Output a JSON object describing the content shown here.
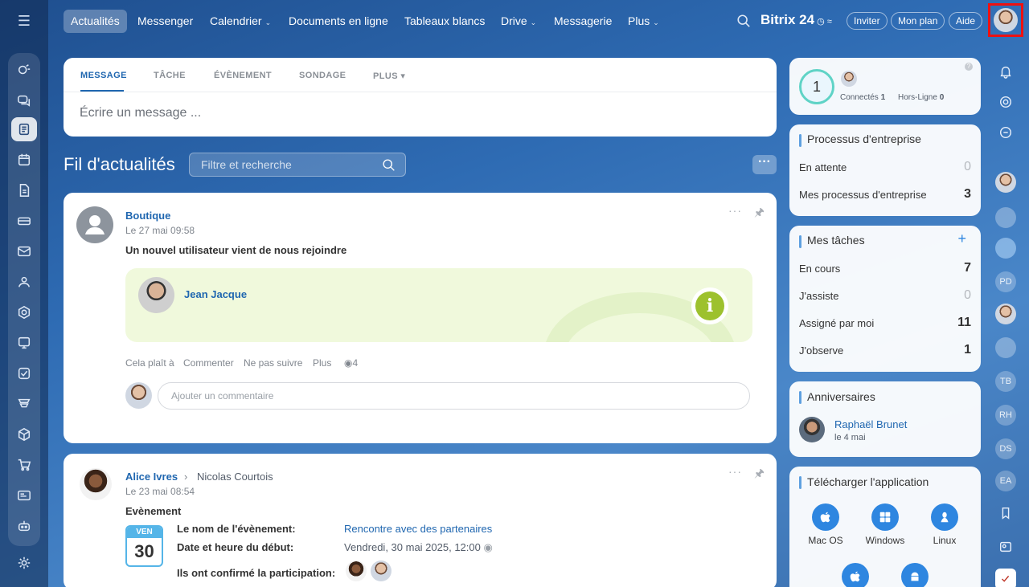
{
  "topbar": {
    "tabs": [
      {
        "label": "Actualités",
        "active": true
      },
      {
        "label": "Messenger"
      },
      {
        "label": "Calendrier",
        "dropdown": true
      },
      {
        "label": "Documents en ligne"
      },
      {
        "label": "Tableaux blancs"
      },
      {
        "label": "Drive",
        "dropdown": true
      },
      {
        "label": "Messagerie"
      },
      {
        "label": "Plus",
        "dropdown": true
      }
    ],
    "brand": "Bitrix 24",
    "invite_label": "Inviter",
    "plan_label": "Mon plan",
    "help_label": "Aide"
  },
  "composer": {
    "tabs": [
      "MESSAGE",
      "TÂCHE",
      "ÉVÈNEMENT",
      "SONDAGE",
      "PLUS"
    ],
    "placeholder": "Écrire un message ..."
  },
  "feed": {
    "title": "Fil d'actualités",
    "search_placeholder": "Filtre et recherche"
  },
  "post1": {
    "author": "Boutique",
    "date": "Le 27 mai 09:58",
    "text": "Un nouvel utilisateur vient de nous rejoindre",
    "new_user": "Jean Jacque",
    "actions": {
      "like": "Cela plaît à",
      "comment": "Commenter",
      "unfollow": "Ne pas suivre",
      "more": "Plus",
      "views": "4"
    },
    "comment_placeholder": "Ajouter un commentaire"
  },
  "post2": {
    "author": "Alice Ivres",
    "recipient": "Nicolas Courtois",
    "date": "Le 23 mai 08:54",
    "type": "Evènement",
    "calendar_day": "VEN",
    "calendar_num": "30",
    "event_name_label": "Le nom de l'évènement:",
    "event_name": "Rencontre avec des partenaires",
    "start_label": "Date et heure du début:",
    "start_value": "Vendredi, 30 mai 2025, 12:00",
    "confirmed_label": "Ils ont confirmé la participation:"
  },
  "widgets": {
    "online": {
      "count": "1",
      "connected_label": "Connectés",
      "connected_count": "1",
      "offline_label": "Hors-Ligne",
      "offline_count": "0"
    },
    "processes": {
      "title": "Processus d'entreprise",
      "rows": [
        {
          "label": "En attente",
          "value": "0"
        },
        {
          "label": "Mes processus d'entreprise",
          "value": "3"
        }
      ]
    },
    "tasks": {
      "title": "Mes tâches",
      "rows": [
        {
          "label": "En cours",
          "value": "7"
        },
        {
          "label": "J'assiste",
          "value": "0"
        },
        {
          "label": "Assigné par moi",
          "value": "11"
        },
        {
          "label": "J'observe",
          "value": "1"
        }
      ]
    },
    "birthdays": {
      "title": "Anniversaires",
      "name": "Raphaël Brunet",
      "date": "le 4 mai"
    },
    "apps": {
      "title": "Télécharger l'application",
      "items": [
        "Mac OS",
        "Windows",
        "Linux"
      ]
    }
  },
  "right_sidebar": {
    "initials": [
      "PD",
      "TB",
      "RH",
      "DS",
      "EA"
    ]
  },
  "colors": {
    "accent": "#2067b0",
    "info_bg": "#f0f9dc",
    "info_badge": "#9dc12e",
    "highlight": "#e11111"
  }
}
